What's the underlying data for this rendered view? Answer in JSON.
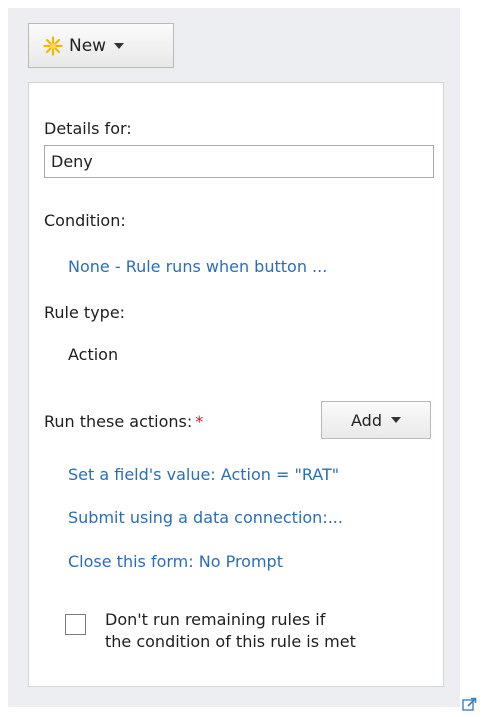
{
  "toolbar": {
    "new_label": "New",
    "new_icon": "new-star-icon"
  },
  "details": {
    "details_for_label": "Details for:",
    "name_value": "Deny",
    "condition_label": "Condition:",
    "condition_link": "None - Rule runs when button ...",
    "rule_type_label": "Rule type:",
    "rule_type_value": "Action",
    "actions_label": "Run these actions:",
    "required_marker": "*",
    "add_label": "Add",
    "actions": [
      "Set a field's value: Action = \"RAT\"",
      "Submit using a data connection:...",
      "Close this form: No Prompt"
    ],
    "stop_rules_line1": "Don't run remaining rules if",
    "stop_rules_line2": "the condition of this rule is met",
    "stop_rules_checked": false
  },
  "colors": {
    "link": "#2a6ebb",
    "required": "#d11c1c",
    "pane_background": "#eceef1"
  },
  "popout_icon": "popout-icon"
}
